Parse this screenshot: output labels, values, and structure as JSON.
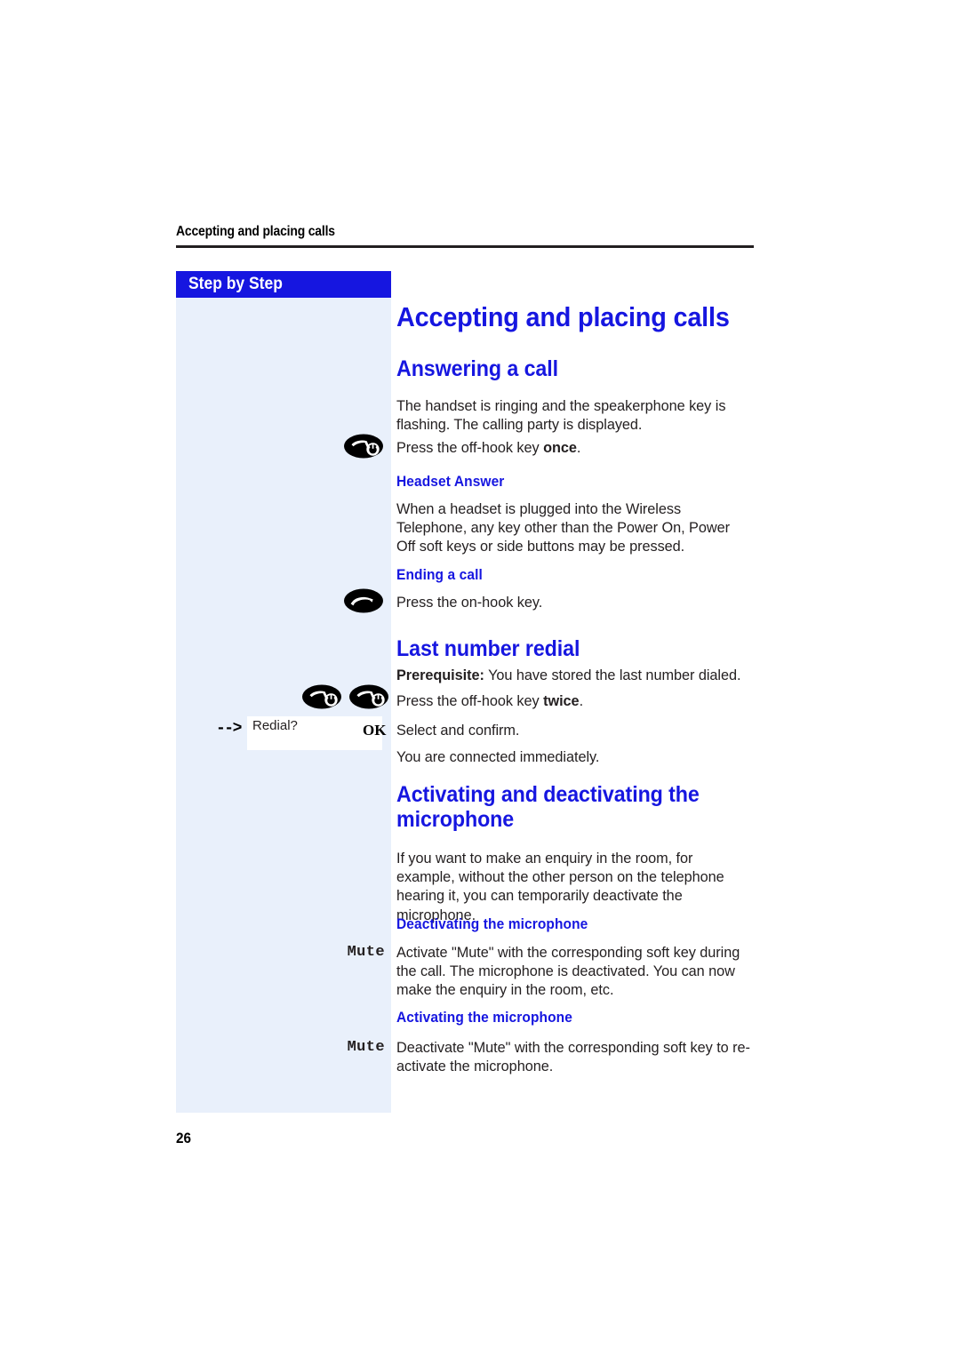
{
  "page": {
    "running_header": "Accepting and placing calls",
    "folio": "26",
    "sidebar_banner": "Step by Step",
    "colors": {
      "accent_blue": "#1616e0",
      "sidebar_fill": "#e9f0fb",
      "body_text": "#231f20",
      "rule": "#231f20"
    }
  },
  "content": {
    "title": "Accepting and placing calls",
    "sections": [
      {
        "heading": "Answering a call",
        "paragraph_1": "The handset is ringing and the speakerphone key is flashing. The calling party is displayed.",
        "step_offhook_once": {
          "icon": "off-hook-key-icon",
          "text_before": "Press the off-hook key ",
          "text_bold": "once",
          "text_after": "."
        },
        "subheading_1": "Headset Answer",
        "paragraph_2": "When a headset is plugged into the Wireless Telephone, any key other than the Power On, Power Off soft keys or side buttons may be pressed.",
        "subheading_2": "Ending a call",
        "step_onhook": {
          "icon": "on-hook-key-icon",
          "text": "Press the on-hook key."
        }
      },
      {
        "heading": "Last number redial",
        "prerequisite_label": "Prerequisite:",
        "prerequisite_text": " You have stored the last number dialed.",
        "step_offhook_twice": {
          "icon": "off-hook-key-icon",
          "text_before": "Press the off-hook key ",
          "text_bold": "twice",
          "text_after": "."
        },
        "step_redial": {
          "arrow": "-->",
          "display_value": "Redial?",
          "softkey": "OK",
          "text": "Select and confirm."
        },
        "paragraph_after": "You are connected immediately."
      },
      {
        "heading_line_1": "Activating and deactivating the",
        "heading_line_2": "microphone",
        "paragraph_1": "If you want to make an enquiry in the room, for example, without the other person on the telephone hearing it, you can temporarily deactivate the microphone.",
        "subheading_1": "Deactivating the microphone",
        "step_mute_off": {
          "key": "Mute",
          "text": "Activate \"Mute\" with the corresponding soft key during the call. The microphone is deactivated. You can now make the enquiry in the room, etc."
        },
        "subheading_2": "Activating the microphone",
        "step_mute_on": {
          "key": "Mute",
          "text": "Deactivate \"Mute\" with the corresponding soft key to re-activate the microphone."
        }
      }
    ]
  }
}
